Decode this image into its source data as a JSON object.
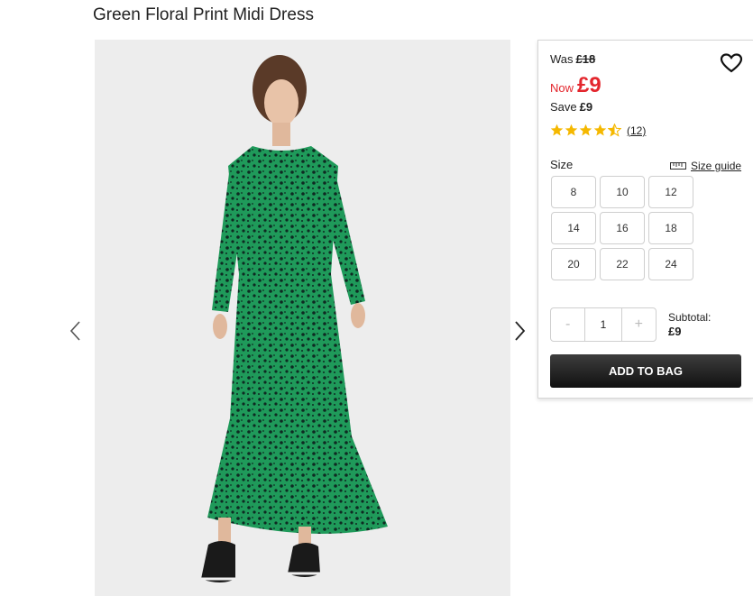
{
  "product": {
    "title": "Green Floral Print Midi Dress",
    "image_alt": "Woman wearing a green floral print midi dress with black trainers"
  },
  "pricing": {
    "was_label": "Was",
    "was_price": "£18",
    "now_label": "Now",
    "now_price": "£9",
    "save_label": "Save",
    "save_value": "£9",
    "accent_color": "#e3262d"
  },
  "rating": {
    "stars": 4.5,
    "count_text": "(12)",
    "star_color": "#f5b800"
  },
  "size": {
    "label": "Size",
    "guide_label": "Size guide",
    "options": [
      "8",
      "10",
      "12",
      "14",
      "16",
      "18",
      "20",
      "22",
      "24"
    ]
  },
  "quantity": {
    "minus": "-",
    "value": "1",
    "plus": "+"
  },
  "subtotal": {
    "label": "Subtotal:",
    "value": "£9"
  },
  "cta": {
    "add_to_bag": "ADD TO BAG"
  },
  "icons": {
    "favourite": "heart-outline-icon",
    "prev": "chevron-left-icon",
    "next": "chevron-right-icon",
    "size_guide": "ruler-icon"
  }
}
